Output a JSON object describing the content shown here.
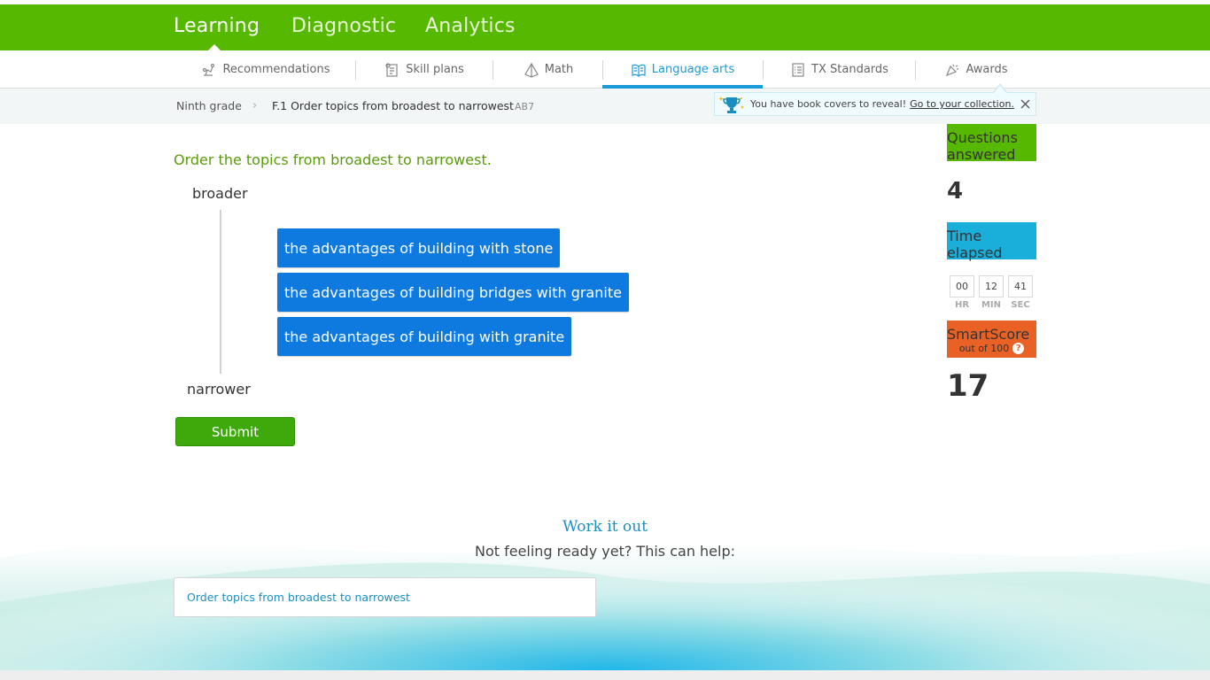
{
  "top_nav": {
    "items": [
      {
        "label": "Learning",
        "active": true
      },
      {
        "label": "Diagnostic",
        "active": false
      },
      {
        "label": "Analytics",
        "active": false
      }
    ]
  },
  "sub_nav": {
    "tabs": [
      {
        "label": "Recommendations",
        "icon": "recommendations-icon"
      },
      {
        "label": "Skill plans",
        "icon": "skill-plans-icon"
      },
      {
        "label": "Math",
        "icon": "math-icon"
      },
      {
        "label": "Language arts",
        "icon": "book-icon",
        "active": true
      },
      {
        "label": "TX Standards",
        "icon": "standards-icon"
      },
      {
        "label": "Awards",
        "icon": "awards-icon"
      }
    ]
  },
  "breadcrumb": {
    "grade": "Ninth grade",
    "skill": "F.1 Order topics from broadest to narrowest",
    "code": "AB7"
  },
  "notice": {
    "text": "You have book covers to reveal!",
    "link": "Go to your collection."
  },
  "question": {
    "prompt": "Order the topics from broadest to narrowest.",
    "top_label": "broader",
    "bottom_label": "narrower",
    "tiles": [
      "the advantages of building with stone",
      "the advantages of building bridges with granite",
      "the advantages of building with granite"
    ],
    "submit_label": "Submit"
  },
  "stats": {
    "questions_answered_label": "Questions answered",
    "questions_answered": "4",
    "time_elapsed_label": "Time elapsed",
    "time": {
      "hr": "00",
      "min": "12",
      "sec": "41"
    },
    "time_units": {
      "hr": "HR",
      "min": "MIN",
      "sec": "SEC"
    },
    "smartscore_label": "SmartScore",
    "smartscore_sub": "out of 100",
    "smartscore_help": "?",
    "smartscore": "17"
  },
  "footer": {
    "heading": "Work it out",
    "subheading": "Not feeling ready yet? This can help:",
    "help_link": "Order topics from broadest to narrowest"
  },
  "colors": {
    "brand_green": "#56b900",
    "tile_blue": "#0e7ae0",
    "active_tab": "#1a9bd7",
    "time_header": "#1aaedb",
    "smartscore_header": "#ea6125"
  }
}
